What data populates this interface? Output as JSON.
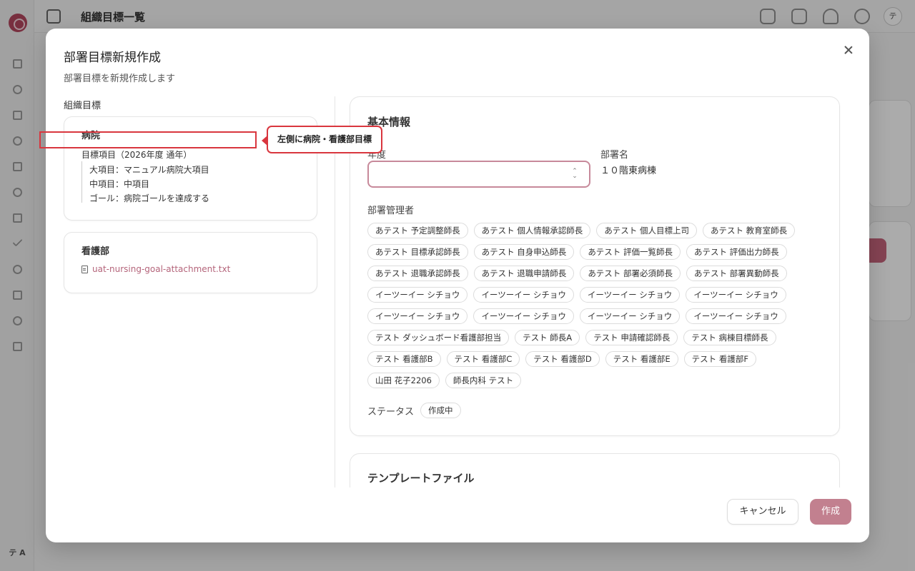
{
  "background": {
    "header_title": "組織目標一覧",
    "avatar_initial": "テ",
    "sidebar_user_initials": "テ A"
  },
  "modal": {
    "title": "部署目標新規作成",
    "description": "部署目標を新規作成します",
    "left": {
      "heading": "組織目標",
      "hospital_card": {
        "title": "病院",
        "goal_header": "目標項目（2026年度 通年）",
        "major_item": "大項目：マニュアル病院大項目",
        "middle_item": "中項目：中項目",
        "goal": "ゴール：病院ゴールを達成する"
      },
      "nursing_card": {
        "title": "看護部",
        "attachment": "uat-nursing-goal-attachment.txt"
      },
      "callout": "左側に病院・看護部目標"
    },
    "basic_info": {
      "title": "基本情報",
      "year_label": "年度",
      "year_value": "",
      "dept_label": "部署名",
      "dept_value": "１０階東病棟",
      "managers_label": "部署管理者",
      "managers": [
        "あテスト 予定調整師長",
        "あテスト 個人情報承認師長",
        "あテスト 個人目標上司",
        "あテスト 教育室師長",
        "あテスト 目標承認師長",
        "あテスト 自身申込師長",
        "あテスト 評価一覧師長",
        "あテスト 評価出力師長",
        "あテスト 退職承認師長",
        "あテスト 退職申請師長",
        "あテスト 部署必須師長",
        "あテスト 部署異動師長",
        "イーツーイー シチョウ",
        "イーツーイー シチョウ",
        "イーツーイー シチョウ",
        "イーツーイー シチョウ",
        "イーツーイー シチョウ",
        "イーツーイー シチョウ",
        "イーツーイー シチョウ",
        "イーツーイー シチョウ",
        "テスト ダッシュボード看護部担当",
        "テスト 師長A",
        "テスト 申請確認師長",
        "テスト 病棟目標師長",
        "テスト 看護部B",
        "テスト 看護部C",
        "テスト 看護部D",
        "テスト 看護部E",
        "テスト 看護部F",
        "山田 花子2206",
        "師長内科 テスト"
      ],
      "status_label": "ステータス",
      "status_value": "作成中"
    },
    "template": {
      "title": "テンプレートファイル"
    },
    "buttons": {
      "cancel": "キャンセル",
      "create": "作成"
    }
  },
  "colors": {
    "accent": "#c2808f",
    "highlight": "#d9363e",
    "link": "#b4647a"
  }
}
